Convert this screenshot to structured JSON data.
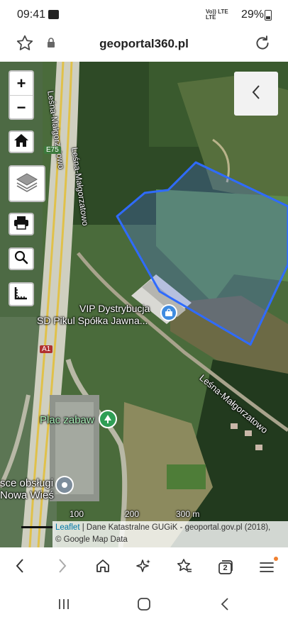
{
  "status_bar": {
    "time": "09:41",
    "network_line1": "Vo)) LTE",
    "network_line2": "LTE",
    "battery_percent": "29%"
  },
  "browser": {
    "url": "geoportal360.pl"
  },
  "map": {
    "labels": {
      "road_lesna_malgorzatowo_north": "Leśna-Małgorzatowo",
      "road_lesna_malgorzatowo_south": "Leśna-Małgorzatowo",
      "road_lesna_malgorzatowo_top": "Leśna-Małgorzatowo",
      "highway_e75": "E75",
      "highway_a1": "A1",
      "poi_vip_line1": "VIP Dystrybucja",
      "poi_vip_line2": "SD Pikul Spółka Jawna...",
      "poi_playground": "Plac zabaw",
      "poi_service_line1": "sce obsługi",
      "poi_service_line2": "Nowa Wieś"
    },
    "zoom_in_label": "+",
    "zoom_out_label": "−",
    "scale_labels": [
      "100",
      "200",
      "300 m"
    ],
    "attribution": {
      "leaflet": "Leaflet",
      "separator": " | ",
      "text": "Dane Katastralne GUGiK - geoportal.gov.pl (2018),",
      "line2": "© Google Map Data"
    },
    "colors": {
      "parcel_outline": "#2f6bff",
      "parcel_fill": "rgba(80,120,255,0.25)"
    }
  },
  "bottom_toolbar": {
    "tabs_count": "2"
  }
}
